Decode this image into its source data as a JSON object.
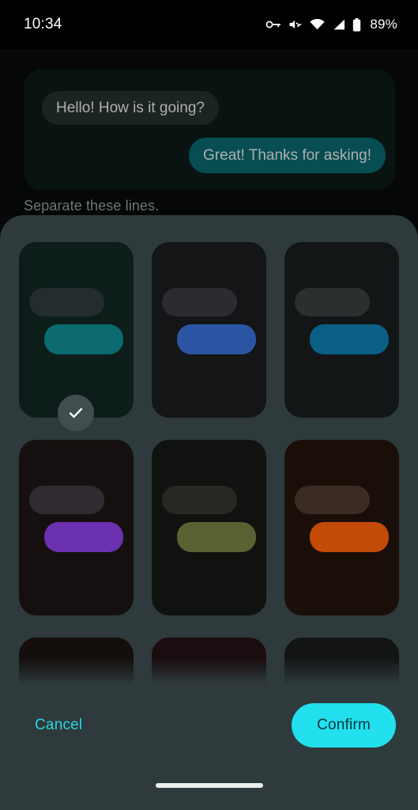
{
  "status_bar": {
    "time": "10:34",
    "battery_percent": "89%",
    "icons": [
      "vpn-key-icon",
      "mute-icon",
      "wifi-icon",
      "cell-signal-icon",
      "battery-icon"
    ]
  },
  "app_preview": {
    "incoming_message": "Hello! How is it going?",
    "outgoing_message": "Great! Thanks for asking!",
    "body_text": "Separate these lines.",
    "panel_bg": "#0d1c1a",
    "incoming_bubble_color": "#27322f",
    "outgoing_bubble_color": "#0a6b72"
  },
  "theme_sheet": {
    "background": "#2e3a3c",
    "selected_index": 0,
    "check_icon": "check-icon",
    "themes": [
      {
        "name": "teal-dark",
        "card_bg": "#0c1d1a",
        "in_bubble": "#232d2e",
        "out_bubble": "#0b6b70",
        "selected": true
      },
      {
        "name": "blue-dark",
        "card_bg": "#131516",
        "in_bubble": "#2a2c31",
        "out_bubble": "#2c54a4",
        "selected": false
      },
      {
        "name": "cyan-dark",
        "card_bg": "#131616",
        "in_bubble": "#2c2f30",
        "out_bubble": "#0a5f85",
        "selected": false
      },
      {
        "name": "purple-dark",
        "card_bg": "#15100f",
        "in_bubble": "#302b30",
        "out_bubble": "#6b31b0",
        "selected": false
      },
      {
        "name": "olive-dark",
        "card_bg": "#101210",
        "in_bubble": "#272724",
        "out_bubble": "#5a6132",
        "selected": false
      },
      {
        "name": "orange-dark",
        "card_bg": "#1a0f08",
        "in_bubble": "#3a2b23",
        "out_bubble": "#c44a08",
        "selected": false
      },
      {
        "name": "row3-a",
        "card_bg": "#140e0c",
        "in_bubble": "#241a16",
        "out_bubble": "#241a16",
        "selected": false
      },
      {
        "name": "row3-b",
        "card_bg": "#1a0d10",
        "in_bubble": "#2a171c",
        "out_bubble": "#2a171c",
        "selected": false
      },
      {
        "name": "row3-c",
        "card_bg": "#131515",
        "in_bubble": "#202323",
        "out_bubble": "#202323",
        "selected": false
      }
    ],
    "cancel_label": "Cancel",
    "confirm_label": "Confirm",
    "cancel_color": "#2ad6e6",
    "confirm_bg": "#22e0ee",
    "confirm_text_color": "#06343a"
  },
  "nav_bar": {
    "home_indicator": "home-indicator"
  }
}
